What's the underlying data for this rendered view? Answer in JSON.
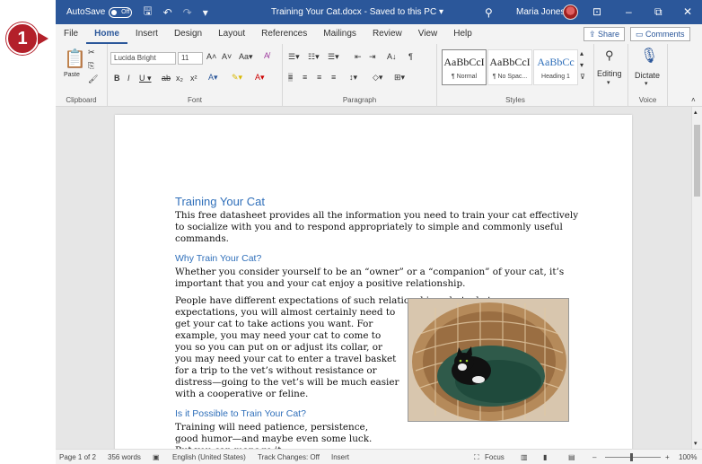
{
  "titlebar": {
    "autosave_label": "AutoSave",
    "autosave_state": "Off",
    "doc_title": "Training Your Cat.docx  -  Saved to this PC  ▾",
    "user_name": "Maria Jones"
  },
  "callout_number": "1",
  "tabs": [
    {
      "label": "File"
    },
    {
      "label": "Home"
    },
    {
      "label": "Insert"
    },
    {
      "label": "Design"
    },
    {
      "label": "Layout"
    },
    {
      "label": "References"
    },
    {
      "label": "Mailings"
    },
    {
      "label": "Review"
    },
    {
      "label": "View"
    },
    {
      "label": "Help"
    }
  ],
  "active_tab": "Home",
  "share_label": "Share",
  "comments_label": "Comments",
  "ribbon": {
    "clipboard": {
      "paste_label": "Paste",
      "group_label": "Clipboard"
    },
    "font": {
      "font_name": "Lucida Bright",
      "font_size": "11",
      "group_label": "Font"
    },
    "paragraph": {
      "group_label": "Paragraph"
    },
    "styles": {
      "group_label": "Styles",
      "items": [
        {
          "sample": "AaBbCcI",
          "name": "¶ Normal"
        },
        {
          "sample": "AaBbCcI",
          "name": "¶ No Spac..."
        },
        {
          "sample": "AaBbCc",
          "name": "Heading 1"
        }
      ]
    },
    "editing": {
      "label": "Editing"
    },
    "voice": {
      "dictate_label": "Dictate",
      "group_label": "Voice"
    }
  },
  "document": {
    "title": "Training Your Cat",
    "intro": "This free datasheet provides all the information you need to train your cat effectively to socialize with you and to respond appropriately to simple and commonly useful commands.",
    "heading2": "Why Train Your Cat?",
    "para2": "Whether you consider yourself to be an “owner” or a “companion” of your cat, it’s important that you and your cat enjoy a positive relationship.",
    "para3_line1": "People have different expectations of such relationships—but whatever your",
    "para3_rest": "expectations, you will almost certainly need to get your cat to take actions you want. For example, you may need your cat to come to you so you can put on or adjust its collar, or you may need your cat to enter a travel basket for a trip to the vet’s without resistance or distress—going to the vet’s will be much easier with a cooperative or feline.",
    "heading3": "Is it Possible to Train Your Cat?",
    "para4": "Training will need patience, persistence, good humor—and maybe even some luck. But you can manage it."
  },
  "statusbar": {
    "page": "Page 1 of 2",
    "words": "356 words",
    "language": "English (United States)",
    "track_changes": "Track Changes: Off",
    "mode": "Insert",
    "focus": "Focus",
    "zoom": "100%"
  }
}
